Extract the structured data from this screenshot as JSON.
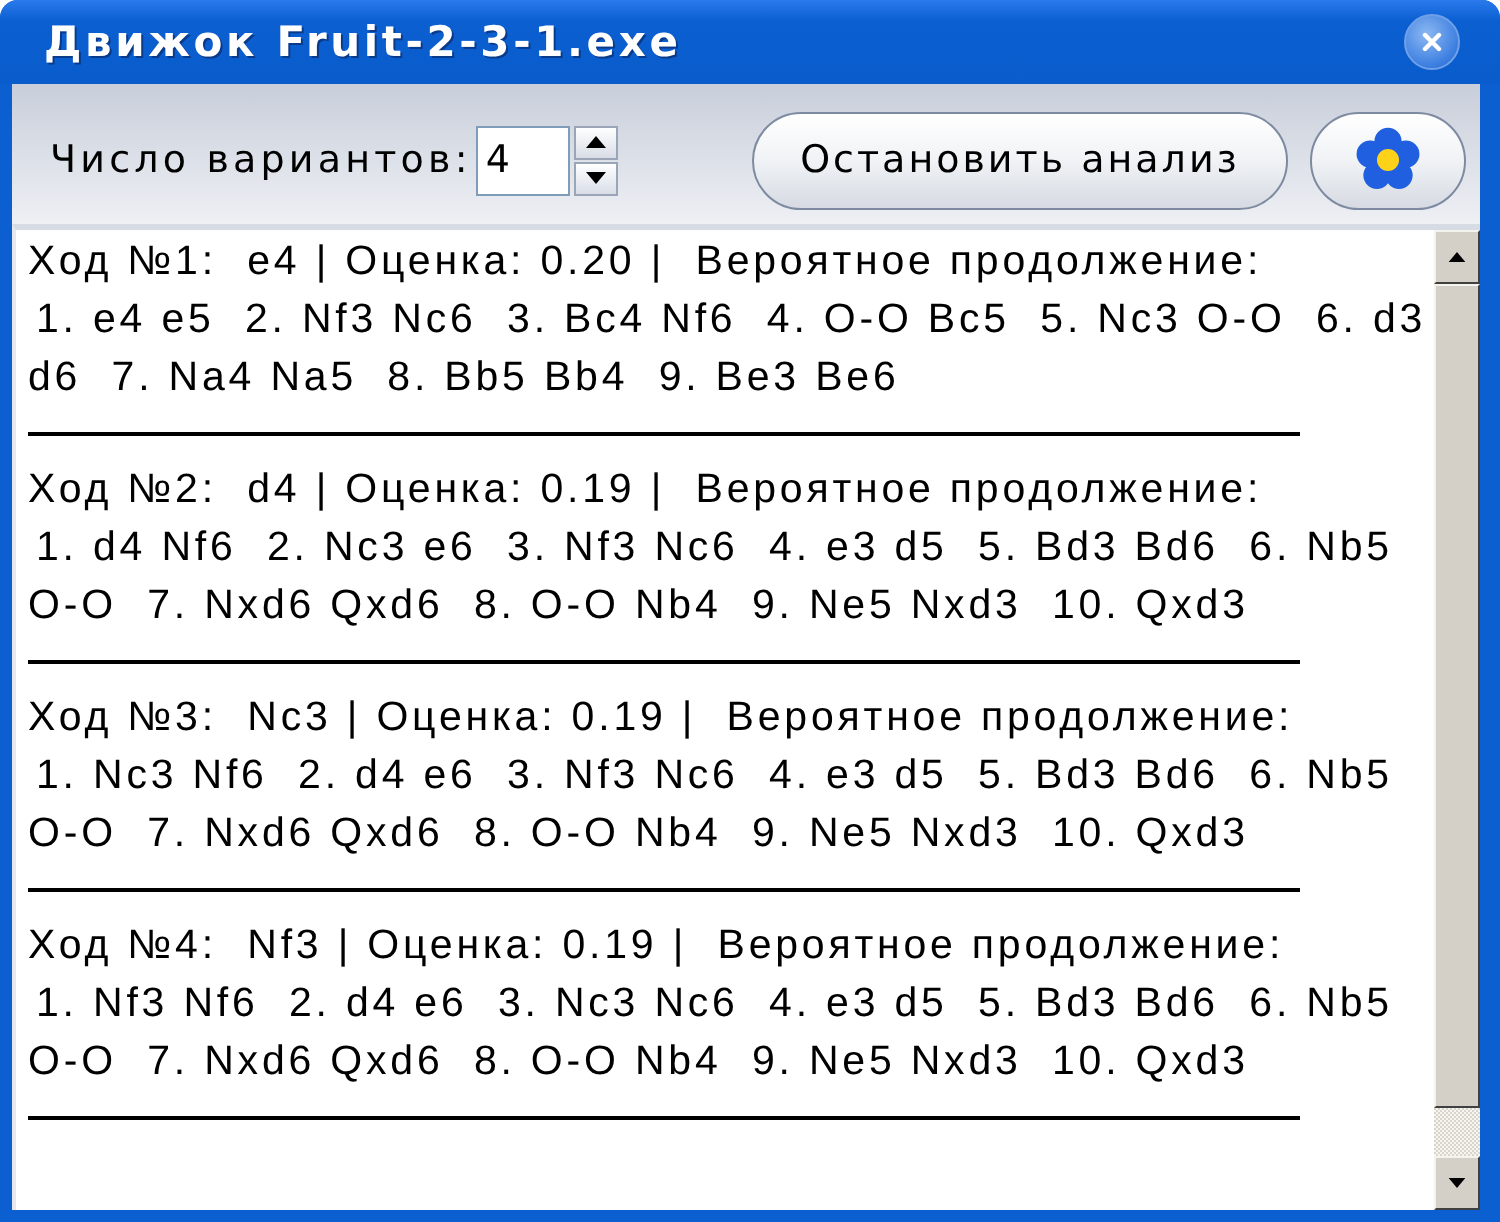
{
  "window": {
    "title": "Движок Fruit-2-3-1.exe"
  },
  "toolbar": {
    "variants_label": "Число вариантов:",
    "variants_value": "4",
    "stop_button": "Остановить анализ"
  },
  "output": {
    "entries": [
      {
        "heading": "Ход №1:  e4 | Оценка: 0.20 |  Вероятное продолжение:",
        "lines": [
          "1. e4 e5  2. Nf3 Nc6  3. Bc4 Nf6  4. O-O Bc5  5. Nc3 O-O  6. d3",
          "d6  7. Na4 Na5  8. Bb5 Bb4  9. Be3 Be6"
        ]
      },
      {
        "heading": "Ход №2:  d4 | Оценка: 0.19 |  Вероятное продолжение:",
        "lines": [
          "1. d4 Nf6  2. Nc3 e6  3. Nf3 Nc6  4. e3 d5  5. Bd3 Bd6  6. Nb5",
          "O-O  7. Nxd6 Qxd6  8. O-O Nb4  9. Ne5 Nxd3  10. Qxd3"
        ]
      },
      {
        "heading": "Ход №3:  Nc3 | Оценка: 0.19 |  Вероятное продолжение:",
        "lines": [
          "1. Nc3 Nf6  2. d4 e6  3. Nf3 Nc6  4. e3 d5  5. Bd3 Bd6  6. Nb5",
          "O-O  7. Nxd6 Qxd6  8. O-O Nb4  9. Ne5 Nxd3  10. Qxd3"
        ]
      },
      {
        "heading": "Ход №4:  Nf3 | Оценка: 0.19 |  Вероятное продолжение:",
        "lines": [
          "1. Nf3 Nf6  2. d4 e6  3. Nc3 Nc6  4. e3 d5  5. Bd3 Bd6  6. Nb5",
          "O-O  7. Nxd6 Qxd6  8. O-O Nb4  9. Ne5 Nxd3  10. Qxd3"
        ]
      }
    ]
  }
}
